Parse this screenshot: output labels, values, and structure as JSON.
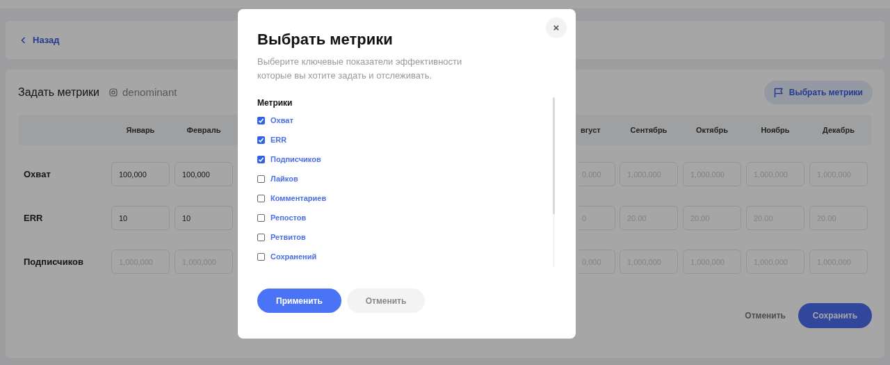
{
  "back_link": {
    "label": "Назад"
  },
  "page": {
    "title": "Задать метрики",
    "account": "denominant",
    "select_button": "Выбрать метрики",
    "columns": [
      {
        "label": "Январь",
        "kind": "full"
      },
      {
        "label": "Февраль",
        "kind": "full"
      },
      {
        "label": "вгуст",
        "kind": "partial"
      },
      {
        "label": "Сентябрь",
        "kind": "full"
      },
      {
        "label": "Октябрь",
        "kind": "full"
      },
      {
        "label": "Ноябрь",
        "kind": "full"
      },
      {
        "label": "Декабрь",
        "kind": "full"
      }
    ],
    "rows": [
      {
        "label": "Охват",
        "cells": [
          {
            "value": "100,000"
          },
          {
            "value": "100,000"
          },
          {
            "placeholder": "0,000"
          },
          {
            "placeholder": "1,000,000"
          },
          {
            "placeholder": "1,000,000"
          },
          {
            "placeholder": "1,000,000"
          },
          {
            "placeholder": "1,000,000"
          }
        ]
      },
      {
        "label": "ERR",
        "cells": [
          {
            "value": "10"
          },
          {
            "value": "10"
          },
          {
            "placeholder": "0"
          },
          {
            "placeholder": "20.00"
          },
          {
            "placeholder": "20.00"
          },
          {
            "placeholder": "20.00"
          },
          {
            "placeholder": "20.00"
          }
        ]
      },
      {
        "label": "Подписчиков",
        "cells": [
          {
            "placeholder": "1,000,000"
          },
          {
            "placeholder": "1,000,000"
          },
          {
            "placeholder": "0,000"
          },
          {
            "placeholder": "1,000,000"
          },
          {
            "placeholder": "1,000,000"
          },
          {
            "placeholder": "1,000,000"
          },
          {
            "placeholder": "1,000,000"
          }
        ]
      }
    ],
    "cancel_button": "Отменить",
    "save_button": "Сохранить"
  },
  "modal": {
    "title": "Выбрать метрики",
    "close": "×",
    "description": "Выберите ключевые показатели эффективности которые вы хотите задать и отслеживать.",
    "list_title": "Метрики",
    "metrics": [
      {
        "label": "Охват",
        "checked": true
      },
      {
        "label": "ERR",
        "checked": true
      },
      {
        "label": "Подписчиков",
        "checked": true
      },
      {
        "label": "Лайков",
        "checked": false
      },
      {
        "label": "Комментариев",
        "checked": false
      },
      {
        "label": "Репостов",
        "checked": false
      },
      {
        "label": "Ретвитов",
        "checked": false
      },
      {
        "label": "Сохранений",
        "checked": false
      }
    ],
    "apply_button": "Применить",
    "cancel_button": "Отменить"
  }
}
